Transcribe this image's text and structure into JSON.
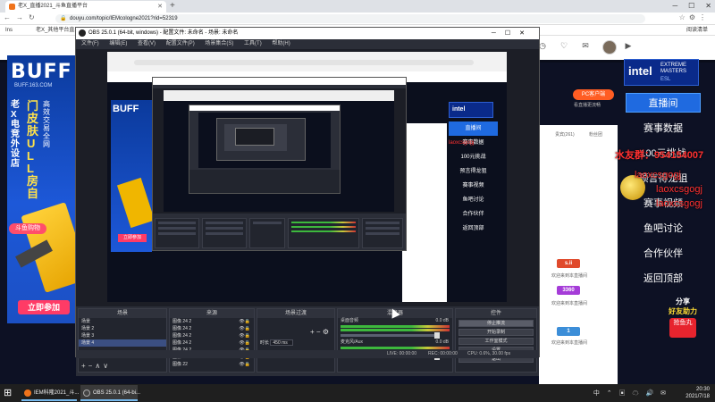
{
  "browser": {
    "tab_title": "老X_直播2021_斗鱼直播平台",
    "url": "douyu.com/topic/IEMcologne2021?rid=52319",
    "bookmarks": [
      "Ins",
      "老X_其他平台直..."
    ],
    "toolbar_right_label": "阅读清单"
  },
  "obs": {
    "title": "OBS 25.0.1 (64-bit, windows) - 配置文件: 未命名 - 场景: 未命名",
    "menu": [
      "文件(F)",
      "编辑(E)",
      "查看(V)",
      "配置文件(P)",
      "场景集合(S)",
      "工具(T)",
      "帮助(H)"
    ],
    "docks": {
      "scenes_title": "场景",
      "scenes": [
        "场景",
        "场景 2",
        "场景 3",
        "场景 4"
      ],
      "sources_title": "来源",
      "sources": [
        "图像 24 2",
        "图像 24 2",
        "图像 24 2",
        "图像 24 2",
        "图像 24 2",
        "图像 23",
        "图像 22"
      ],
      "transitions_title": "场景过渡",
      "transition_duration_label": "时长",
      "transition_duration": "450 ms",
      "mixer_title": "混音器",
      "mixer": [
        {
          "name": "桌面音频",
          "db": "0.0 dB"
        },
        {
          "name": "麦克风/Aux",
          "db": "0.0 dB"
        }
      ],
      "controls_title": "控件",
      "controls": [
        "停止推流",
        "开始录制",
        "工作室模式",
        "设置",
        "退出"
      ]
    },
    "status": {
      "live": "LIVE: 00:00:00",
      "rec": "REC: 00:00:00",
      "cpu": "CPU: 0.6%, 30.00 fps"
    }
  },
  "douyu": {
    "buff_logo": "BUFF",
    "buff_url": "BUFF.163.COM",
    "buff_vtext_1": "老X电竞外设店",
    "buff_vtext_2": "门皮肤ULL房自",
    "buff_vtext_3": "高效交易全网",
    "buff_shop_badge": "斗鱼购物",
    "buff_join": "立即参加",
    "esl_logo": {
      "intel": "intel",
      "line1": "EXTREME",
      "line2": "MASTERS",
      "badge": "ESL"
    },
    "esl_menu": [
      "直播间",
      "赛事数据",
      "100元挑战",
      "预言得龙狙",
      "赛事视频",
      "鱼吧讨论",
      "合作伙伴",
      "返回顶部"
    ],
    "pc_client": "PC客户端",
    "pc_client_sub": "看直播更流畅",
    "room_tabs": [
      "贵宾(261)",
      "粉丝团"
    ],
    "overlay_qq": "水友群：954154007",
    "overlay_id": "laoxcsgogj",
    "share": {
      "line1": "分享",
      "line2": "好友助力",
      "line3": "抢鱼丸"
    },
    "chat": [
      {
        "badge": "s.ii",
        "color": "#e04a2c",
        "text": "欢迎来到本直播间"
      },
      {
        "badge": "3360",
        "color": "#a53cd8",
        "text": "欢迎来到本直播间"
      },
      {
        "badge": "1",
        "color": "#3c8ed8",
        "text": "欢迎来到本直播间"
      }
    ]
  },
  "taskbar": {
    "apps": [
      {
        "label": "IEM科隆2021_斗...",
        "color": "#f0731b"
      },
      {
        "label": "OBS 25.0.1 (64-bi...",
        "color": "#444"
      }
    ],
    "time": "20:30",
    "date": "2021/7/18",
    "lang": "中"
  }
}
